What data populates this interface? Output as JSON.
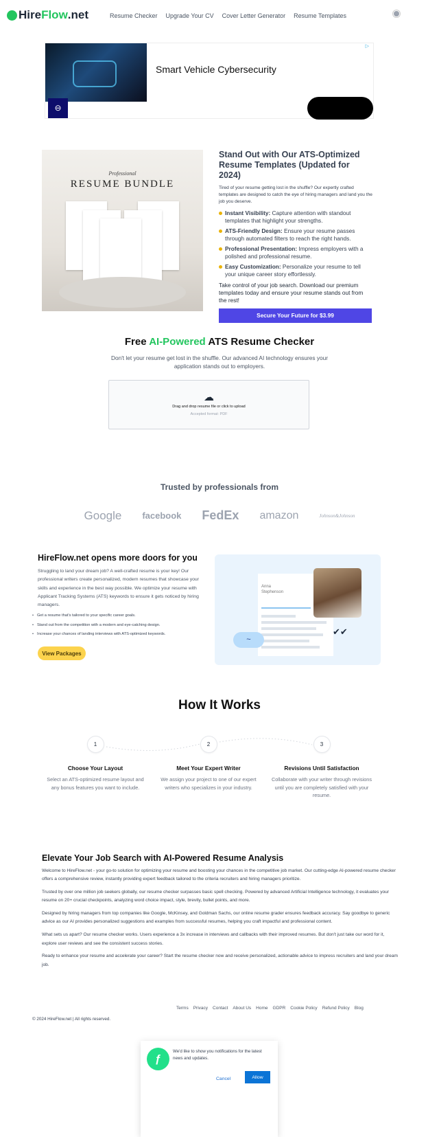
{
  "header": {
    "logo_main": "Hire",
    "logo_accent": "Flow",
    "logo_suffix": ".net",
    "nav": [
      "Resume Checker",
      "Upgrade Your CV",
      "Cover Letter Generator",
      "Resume Templates"
    ]
  },
  "ad": {
    "headline": "Smart Vehicle Cybersecurity"
  },
  "templates": {
    "image_title_script": "Professional",
    "image_title": "RESUME BUNDLE",
    "title": "Stand Out with Our ATS-Optimized Resume Templates (Updated for 2024)",
    "intro": "Tired of your resume getting lost in the shuffle? Our expertly crafted templates are designed to catch the eye of hiring managers and land you the job you deserve.",
    "features": [
      {
        "label": "Instant Visibility:",
        "text": " Capture attention with standout templates that highlight your strengths."
      },
      {
        "label": "ATS-Friendly Design:",
        "text": " Ensure your resume passes through automated filters to reach the right hands."
      },
      {
        "label": "Professional Presentation:",
        "text": " Impress employers with a polished and professional resume."
      },
      {
        "label": "Easy Customization:",
        "text": " Personalize your resume to tell your unique career story effortlessly."
      }
    ],
    "outro": "Take control of your job search. Download our premium templates today and ensure your resume stands out from the rest!",
    "button": "Secure Your Future for $3.99"
  },
  "checker": {
    "title_pre": "Free ",
    "title_accent": "AI-Powered",
    "title_post": " ATS Resume Checker",
    "subtitle": "Don't let your resume get lost in the shuffle. Our advanced AI technology ensures your application stands out to employers.",
    "upload_text": "Drag and drop resume file or click to upload",
    "accepted": "Accepted format: PDF"
  },
  "trusted": {
    "title": "Trusted by professionals from",
    "brands": [
      "Google",
      "facebook",
      "FedEx",
      "amazon",
      "Johnson&Johnson"
    ]
  },
  "doors": {
    "title": "HireFlow.net opens more doors for you",
    "text": "Struggling to land your dream job? A well-crafted resume is your key! Our professional writers create personalized, modern resumes that showcase your skills and experience in the best way possible. We optimize your resume with Applicant Tracking Systems (ATS) keywords to ensure it gets noticed by hiring managers.",
    "bullets": [
      "Get a resume that's tailored to your specific career goals.",
      "Stand out from the competition with a modern and eye-catching design.",
      "Increase your chances of landing interviews with ATS-optimized keywords."
    ],
    "button": "View Packages",
    "illustration_name": "Anna Stephenson"
  },
  "how": {
    "title": "How It Works",
    "steps": [
      {
        "num": "1",
        "title": "Choose Your Layout",
        "desc": "Select an ATS-optimized resume layout and any bonus features you want to include."
      },
      {
        "num": "2",
        "title": "Meet Your Expert Writer",
        "desc": "We assign your project to one of our expert writers who specializes in your industry."
      },
      {
        "num": "3",
        "title": "Revisions Until Satisfaction",
        "desc": "Collaborate with your writer through revisions until you are completely satisfied with your resume."
      }
    ]
  },
  "elevate": {
    "title": "Elevate Your Job Search with AI-Powered Resume Analysis",
    "paragraphs": [
      "Welcome to HireFlow.net - your go-to solution for optimizing your resume and boosting your chances in the competitive job market. Our cutting-edge AI-powered resume checker offers a comprehensive review, instantly providing expert feedback tailored to the criteria recruiters and hiring managers prioritize.",
      "Trusted by over one million job seekers globally, our resume checker surpasses basic spell checking. Powered by advanced Artificial Intelligence technology, it evaluates your resume on 20+ crucial checkpoints, analyzing word choice impact, style, brevity, bullet points, and more.",
      "Designed by hiring managers from top companies like Google, McKinsey, and Goldman Sachs, our online resume grader ensures feedback accuracy. Say goodbye to generic advice as our AI provides personalized suggestions and examples from successful resumes, helping you craft impactful and professional content.",
      "What sets us apart? Our resume checker works. Users experience a 3x increase in interviews and callbacks with their improved resumes. But don't just take our word for it, explore user reviews and see the consistent success stories.",
      "Ready to enhance your resume and accelerate your career? Start the resume checker now and receive personalized, actionable advice to impress recruiters and land your dream job."
    ]
  },
  "footer": {
    "links": [
      "Terms",
      "Privacy",
      "Contact",
      "About Us",
      "Home",
      "GDPR",
      "Cookie Policy",
      "Refund Policy",
      "Blog"
    ],
    "copyright": "© 2024 HireFlow.net | All rights reserved."
  },
  "notification": {
    "message": "We'd like to show you notifications for the latest news and updates.",
    "cancel": "Cancel",
    "allow": "Allow"
  },
  "colors": {
    "accent_green": "#22c55e",
    "cta_indigo": "#4f46e5",
    "yellow": "#fcd34d",
    "allow_blue": "#0b74d6"
  }
}
